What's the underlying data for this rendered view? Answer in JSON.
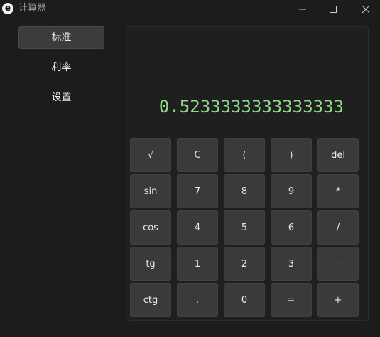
{
  "window": {
    "icon_letter": "e",
    "title": "计算器"
  },
  "sidebar": {
    "items": [
      {
        "label": "标准",
        "active": true
      },
      {
        "label": "利率",
        "active": false
      },
      {
        "label": "设置",
        "active": false
      }
    ]
  },
  "calculator": {
    "display": "0.5233333333333333",
    "display_color": "#8fdc8a",
    "keys": [
      [
        "√",
        "C",
        "(",
        ")",
        "del"
      ],
      [
        "sin",
        "7",
        "8",
        "9",
        "*"
      ],
      [
        "cos",
        "4",
        "5",
        "6",
        "/"
      ],
      [
        "tg",
        "1",
        "2",
        "3",
        "-"
      ],
      [
        "ctg",
        ".",
        "0",
        "=",
        "+"
      ]
    ]
  }
}
